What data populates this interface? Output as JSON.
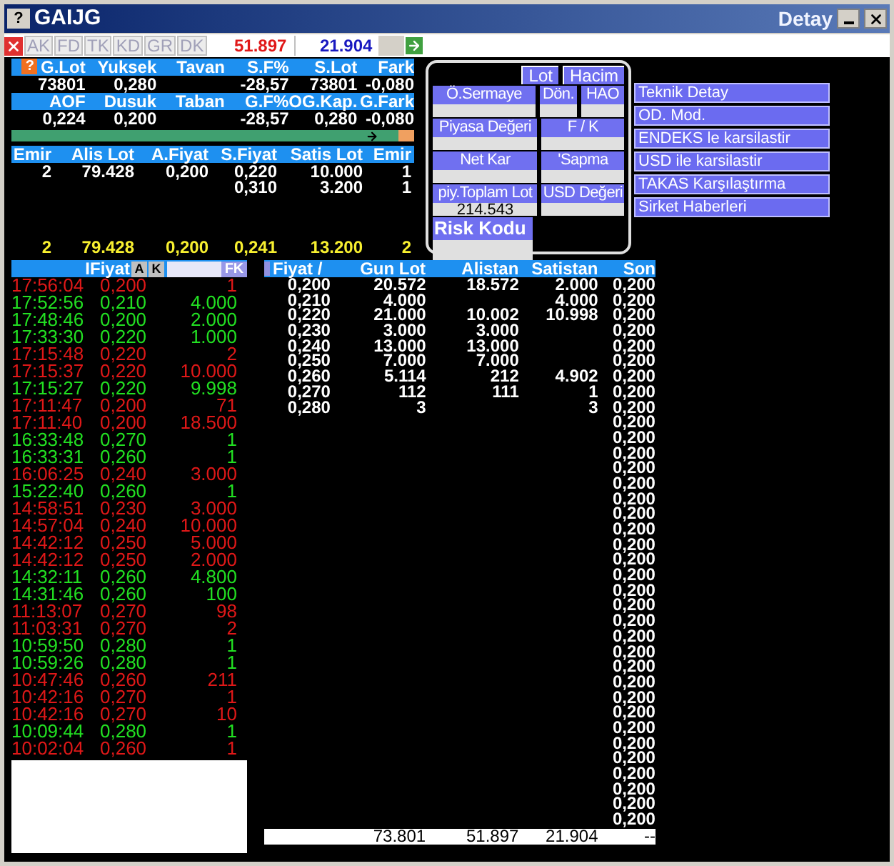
{
  "window": {
    "help": "?",
    "title": "GAIJG",
    "title_right": "Detay"
  },
  "toolbar": {
    "buttons": [
      {
        "label": "AK",
        "disabled": true
      },
      {
        "label": "FD",
        "disabled": true
      },
      {
        "label": "TK",
        "disabled": true
      },
      {
        "label": "KD",
        "disabled": true
      },
      {
        "label": "GR",
        "disabled": true
      },
      {
        "label": "DK",
        "disabled": true
      }
    ],
    "field_1": "51.897",
    "field_2": "21.904"
  },
  "summary_help": "?",
  "summary": [
    [
      {
        "label": "G.Lot",
        "value": "73801"
      },
      {
        "label": "Yuksek",
        "value": "0,280"
      },
      {
        "label": "Tavan"
      },
      {
        "label": "S.F%",
        "value": "-28,57"
      },
      {
        "label": "S.Lot",
        "value": "73801"
      },
      {
        "label": "Fark",
        "value": "-0,080"
      }
    ],
    [
      {
        "label": "AOF",
        "value": "0,224"
      },
      {
        "label": "Dusuk",
        "value": "0,200"
      },
      {
        "label": "Taban"
      },
      {
        "label": "G.F%",
        "value": "-28,57"
      },
      {
        "label": "OG.Kap.",
        "value": "0,280"
      },
      {
        "label": "G.Fark",
        "value": "-0,080"
      }
    ]
  ],
  "balance_bar": {
    "level": 0.96
  },
  "order_book": {
    "columns": [
      "Emir",
      "Alis Lot",
      "A.Fiyat",
      "S.Fiyat",
      "Satis Lot",
      "Emir"
    ],
    "rows": [
      {
        "emir_buy": "2",
        "alis_lot": "79.428",
        "a_fiyat": "0,200",
        "s_fiyat": "0,220",
        "satis_lot": "10.000",
        "emir_sell": "1"
      },
      {
        "s_fiyat": "0,310",
        "satis_lot": "3.200",
        "emir_sell": "1"
      }
    ],
    "totals": [
      "2",
      "79.428",
      "0,200",
      "0,241",
      "13.200",
      "2"
    ]
  },
  "detail_panel": {
    "tabs": [
      {
        "label": "Lot"
      },
      {
        "label": "Hacim"
      }
    ],
    "rows": [
      [
        {
          "label": "Ö.Sermaye"
        },
        {
          "label": "Dön."
        },
        {
          "label": "HAO"
        }
      ],
      [
        {
          "label": "Piyasa Değeri"
        },
        {
          "label": "F / K"
        }
      ],
      [
        {
          "label": "Net Kar"
        },
        {
          "label": "'Sapma"
        }
      ],
      [
        {
          "label": "piy.Toplam Lot",
          "value": "214.543"
        },
        {
          "label": "USD Değeri"
        }
      ],
      [
        {
          "label": "Risk Kodu",
          "kind": "large"
        }
      ]
    ]
  },
  "menu": [
    "Teknik Detay",
    "OD. Mod.",
    "ENDEKS le karsilastir",
    "USD ile karsilastir",
    "TAKAS Karşılaştırma",
    "Sirket Haberleri"
  ],
  "trades": {
    "header": "IFiyat",
    "buttons": [
      "A",
      "K"
    ],
    "right_button": "FK",
    "rows": [
      {
        "time": "17:56:04",
        "price": "0,200",
        "lot": "1",
        "color": "#e01818"
      },
      {
        "time": "17:52:56",
        "price": "0,210",
        "lot": "4.000",
        "color": "#22e022"
      },
      {
        "time": "17:48:46",
        "price": "0,200",
        "lot": "2.000",
        "color": "#22e022"
      },
      {
        "time": "17:33:30",
        "price": "0,220",
        "lot": "1.000",
        "color": "#22e022"
      },
      {
        "time": "17:15:48",
        "price": "0,220",
        "lot": "2",
        "color": "#e01818"
      },
      {
        "time": "17:15:37",
        "price": "0,220",
        "lot": "10.000",
        "color": "#e01818"
      },
      {
        "time": "17:15:27",
        "price": "0,220",
        "lot": "9.998",
        "color": "#22e022"
      },
      {
        "time": "17:11:47",
        "price": "0,200",
        "lot": "71",
        "color": "#e01818"
      },
      {
        "time": "17:11:40",
        "price": "0,200",
        "lot": "18.500",
        "color": "#e01818"
      },
      {
        "time": "16:33:48",
        "price": "0,270",
        "lot": "1",
        "color": "#22e022"
      },
      {
        "time": "16:33:31",
        "price": "0,260",
        "lot": "1",
        "color": "#22e022"
      },
      {
        "time": "16:06:25",
        "price": "0,240",
        "lot": "3.000",
        "color": "#e01818"
      },
      {
        "time": "15:22:40",
        "price": "0,260",
        "lot": "1",
        "color": "#22e022"
      },
      {
        "time": "14:58:51",
        "price": "0,230",
        "lot": "3.000",
        "color": "#e01818"
      },
      {
        "time": "14:57:04",
        "price": "0,240",
        "lot": "10.000",
        "color": "#e01818"
      },
      {
        "time": "14:42:12",
        "price": "0,250",
        "lot": "5.000",
        "color": "#e01818"
      },
      {
        "time": "14:42:12",
        "price": "0,250",
        "lot": "2.000",
        "color": "#e01818"
      },
      {
        "time": "14:32:11",
        "price": "0,260",
        "lot": "4.800",
        "color": "#22e022"
      },
      {
        "time": "14:31:46",
        "price": "0,260",
        "lot": "100",
        "color": "#22e022"
      },
      {
        "time": "11:13:07",
        "price": "0,270",
        "lot": "98",
        "color": "#e01818"
      },
      {
        "time": "11:03:31",
        "price": "0,270",
        "lot": "2",
        "color": "#e01818"
      },
      {
        "time": "10:59:50",
        "price": "0,280",
        "lot": "1",
        "color": "#22e022"
      },
      {
        "time": "10:59:26",
        "price": "0,280",
        "lot": "1",
        "color": "#22e022"
      },
      {
        "time": "10:47:46",
        "price": "0,260",
        "lot": "211",
        "color": "#e01818"
      },
      {
        "time": "10:42:16",
        "price": "0,270",
        "lot": "1",
        "color": "#e01818"
      },
      {
        "time": "10:42:16",
        "price": "0,270",
        "lot": "10",
        "color": "#e01818"
      },
      {
        "time": "10:09:44",
        "price": "0,280",
        "lot": "1",
        "color": "#22e022"
      },
      {
        "time": "10:02:04",
        "price": "0,260",
        "lot": "1",
        "color": "#e01818"
      }
    ]
  },
  "price_table": {
    "columns": [
      "Fiyat /",
      "Gun Lot",
      "Alistan",
      "Satistan",
      "Son"
    ],
    "rows": [
      {
        "fiyat": "0,200",
        "gun_lot": "20.572",
        "alistan": "18.572",
        "satistan": "2.000",
        "son": "0,200"
      },
      {
        "fiyat": "0,210",
        "gun_lot": "4.000",
        "satistan": "4.000",
        "son": "0,200"
      },
      {
        "fiyat": "0,220",
        "gun_lot": "21.000",
        "alistan": "10.002",
        "satistan": "10.998",
        "son": "0,200"
      },
      {
        "fiyat": "0,230",
        "gun_lot": "3.000",
        "alistan": "3.000",
        "son": "0,200"
      },
      {
        "fiyat": "0,240",
        "gun_lot": "13.000",
        "alistan": "13.000",
        "son": "0,200"
      },
      {
        "fiyat": "0,250",
        "gun_lot": "7.000",
        "alistan": "7.000",
        "son": "0,200"
      },
      {
        "fiyat": "0,260",
        "gun_lot": "5.114",
        "alistan": "212",
        "satistan": "4.902",
        "son": "0,200"
      },
      {
        "fiyat": "0,270",
        "gun_lot": "112",
        "alistan": "111",
        "satistan": "1",
        "son": "0,200"
      },
      {
        "fiyat": "0,280",
        "gun_lot": "3",
        "satistan": "3",
        "son": "0,200"
      },
      {
        "son": "0,200"
      },
      {
        "son": "0,200"
      },
      {
        "son": "0,200"
      },
      {
        "son": "0,200"
      },
      {
        "son": "0,200"
      },
      {
        "son": "0,200"
      },
      {
        "son": "0,200"
      },
      {
        "son": "0,200"
      },
      {
        "son": "0,200"
      },
      {
        "son": "0,200"
      },
      {
        "son": "0,200"
      },
      {
        "son": "0,200"
      },
      {
        "son": "0,200"
      },
      {
        "son": "0,200"
      },
      {
        "son": "0,200"
      },
      {
        "son": "0,200"
      },
      {
        "son": "0,200"
      },
      {
        "son": "0,200"
      },
      {
        "son": "0,200"
      },
      {
        "son": "0,200"
      },
      {
        "son": "0,200"
      },
      {
        "son": "0,200"
      },
      {
        "son": "0,200"
      },
      {
        "son": "0,200"
      },
      {
        "son": "0,200"
      },
      {
        "son": "0,200"
      },
      {
        "son": "0,200"
      }
    ],
    "totals": [
      "73.801",
      "51.897",
      "21.904",
      "--"
    ]
  }
}
